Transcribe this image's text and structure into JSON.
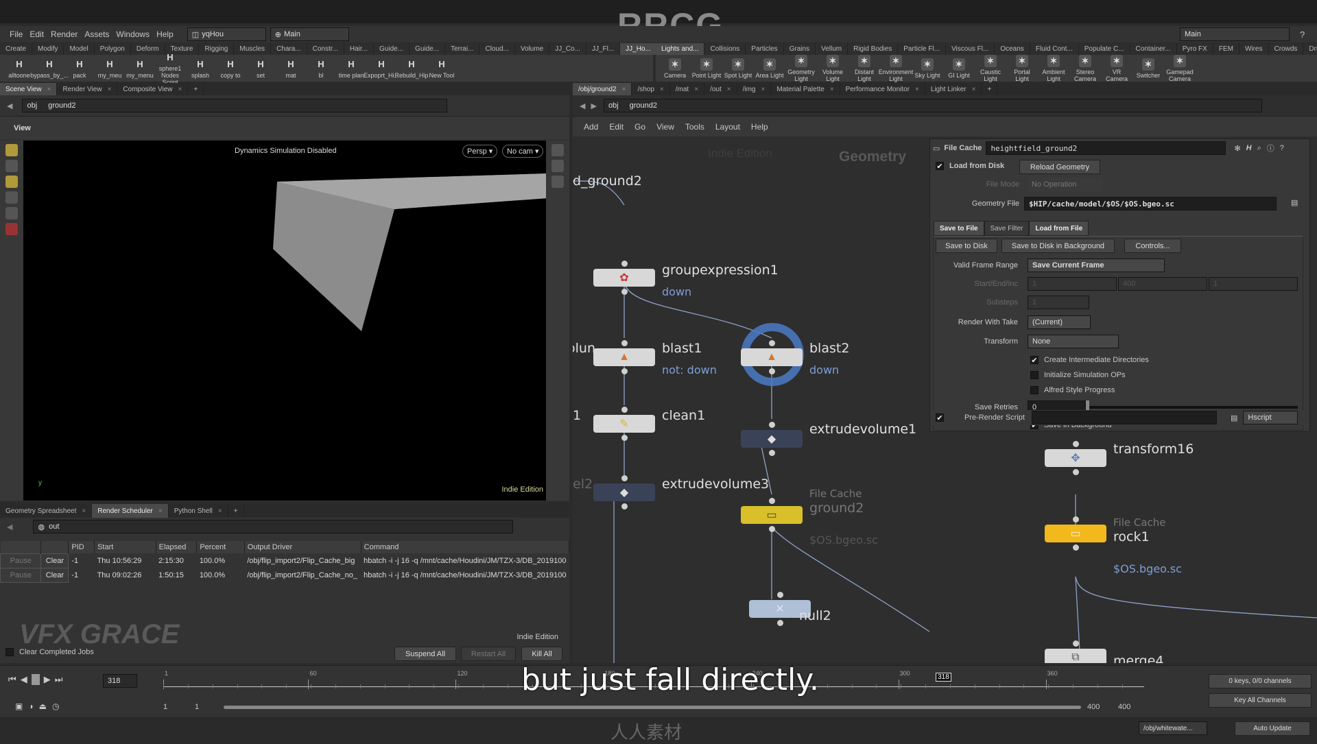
{
  "watermark_logo": "RRCG",
  "menu": {
    "items": [
      "File",
      "Edit",
      "Render",
      "Assets",
      "Windows",
      "Help"
    ],
    "desktop": "yqHou",
    "context": "Main",
    "right_desktop": "Main"
  },
  "shelf_left": {
    "tabs": [
      "Create",
      "Modify",
      "Model",
      "Polygon",
      "Deform",
      "Texture",
      "Rigging",
      "Muscles",
      "Chara...",
      "Constr...",
      "Hair...",
      "Guide...",
      "Guide...",
      "Terrai...",
      "Cloud...",
      "Volume",
      "JJ_Co...",
      "JJ_Fl...",
      "JJ_Ho..."
    ],
    "selected_tab": 18,
    "tools": [
      "alltoone",
      "bypass_by_...",
      "pack",
      "my_meu",
      "my_menu",
      "sphere1 Nodes Script",
      "splash",
      "copy to",
      "set",
      "mat",
      "bl",
      "time plan",
      "Expoprt_Hi...",
      "Rebuild_Hip",
      "New Tool"
    ]
  },
  "shelf_right": {
    "tabs": [
      "Lights and...",
      "Collisions",
      "Particles",
      "Grains",
      "Vellum",
      "Rigid Bodies",
      "Particle Fl...",
      "Viscous Fl...",
      "Oceans",
      "Fluid Cont...",
      "Populate C...",
      "Container...",
      "Pyro FX",
      "FEM",
      "Wires",
      "Crowds",
      "Drive Sim..."
    ],
    "selected_tab": 0,
    "tools": [
      "Camera",
      "Point Light",
      "Spot Light",
      "Area Light",
      "Geometry Light",
      "Volume Light",
      "Distant Light",
      "Environment Light",
      "Sky Light",
      "GI Light",
      "Caustic Light",
      "Portal Light",
      "Ambient Light",
      "Stereo Camera",
      "VR Camera",
      "Switcher",
      "Gamepad Camera"
    ]
  },
  "left_pane": {
    "tabs": [
      "Scene View",
      "Render View",
      "Composite View"
    ],
    "path": [
      "obj",
      "ground2"
    ],
    "view_label": "View",
    "viewport_message": "Dynamics Simulation Disabled",
    "persp": "Persp ▾",
    "cam": "No cam ▾",
    "edition": "Indie Edition",
    "axis_y": "y"
  },
  "scheduler": {
    "tabs": [
      "Geometry Spreadsheet",
      "Render Scheduler",
      "Python Shell"
    ],
    "selected_tab": 1,
    "path": "out",
    "columns": [
      "",
      "",
      "PID",
      "Start",
      "Elapsed",
      "Percent",
      "Output Driver",
      "Command"
    ],
    "rows": [
      {
        "pause": "Pause",
        "clear": "Clear",
        "pid": "-1",
        "start": "Thu 10:56:29",
        "elapsed": "2:15:30",
        "percent": "100.0%",
        "driver": "/obj/flip_import2/Flip_Cache_big",
        "command": "hbatch -i -j 16 -q /mnt/cache/Houdini/JM/TZX-3/DB_2019100"
      },
      {
        "pause": "Pause",
        "clear": "Clear",
        "pid": "-1",
        "start": "Thu 09:02:26",
        "elapsed": "1:50:15",
        "percent": "100.0%",
        "driver": "/obj/flip_import2/Flip_Cache_no_",
        "command": "hbatch -i -j 16 -q /mnt/cache/Houdini/JM/TZX-3/DB_2019100"
      }
    ],
    "edition": "Indie Edition",
    "clear_completed": "Clear Completed Jobs",
    "suspend_all": "Suspend All",
    "restart_all": "Restart All",
    "kill_all": "Kill All",
    "logo": "VFX GRACE"
  },
  "right_pane": {
    "tabs": [
      "/obj/ground2",
      "/shop",
      "/mat",
      "/out",
      "/img",
      "Material Palette",
      "Performance Monitor",
      "Light Linker"
    ],
    "path": [
      "obj",
      "ground2"
    ],
    "menu": [
      "Add",
      "Edit",
      "Go",
      "View",
      "Tools",
      "Layout",
      "Help"
    ],
    "network_watermark": "Indie Edition",
    "network_type": "Geometry"
  },
  "network": {
    "clipped_labels": [
      "d_ground2",
      "olun",
      "1",
      "el2"
    ],
    "nodes": [
      {
        "name": "groupexpression1",
        "sub": "down"
      },
      {
        "name": "blast1",
        "sub": "not: down"
      },
      {
        "name": "blast2",
        "sub": "down"
      },
      {
        "name": "clean1"
      },
      {
        "name": "extrudevolume1"
      },
      {
        "name": "extrudevolume3"
      },
      {
        "name": "ground2",
        "type": "File Cache",
        "sub": "$OS.bgeo.sc"
      },
      {
        "name": "null2"
      },
      {
        "name": "transform16"
      },
      {
        "name": "rock1",
        "type": "File Cache",
        "sub": "$OS.bgeo.sc"
      },
      {
        "name": "merge4"
      }
    ]
  },
  "params": {
    "type": "File Cache",
    "node_name": "heightfield_ground2",
    "load_from_disk": {
      "label": "Load from Disk",
      "checked": true
    },
    "reload": "Reload Geometry",
    "file_mode": {
      "label": "File Mode",
      "value": "No Operation"
    },
    "geometry_file": {
      "label": "Geometry File",
      "value": "$HIP/cache/model/$OS/$OS.bgeo.sc"
    },
    "tabs": [
      "Save to File",
      "Save Filter",
      "Load from File"
    ],
    "save_to_disk": "Save to Disk",
    "save_bg": "Save to Disk in Background",
    "controls": "Controls...",
    "valid_frame_range": {
      "label": "Valid Frame Range",
      "value": "Save Current Frame"
    },
    "start_end_inc": {
      "label": "Start/End/Inc",
      "values": [
        "1",
        "400",
        "1"
      ]
    },
    "substeps": {
      "label": "Substeps",
      "value": "1"
    },
    "render_with_take": {
      "label": "Render With Take",
      "value": "(Current)"
    },
    "transform": {
      "label": "Transform",
      "value": "None"
    },
    "toggles": [
      {
        "label": "Create Intermediate Directories",
        "checked": true
      },
      {
        "label": "Initialize Simulation OPs",
        "checked": false
      },
      {
        "label": "Alfred Style Progress",
        "checked": false
      }
    ],
    "save_retries": {
      "label": "Save Retries",
      "value": "0"
    },
    "save_in_background": {
      "label": "Save in Background",
      "checked": true
    },
    "pre_render": {
      "label": "Pre-Render Script",
      "checked": true,
      "language": "Hscript"
    }
  },
  "timeline": {
    "current_frame": "318",
    "start": 1,
    "end": 400,
    "ticks": [
      "1",
      "60",
      "120",
      "180",
      "240",
      "300",
      "360"
    ],
    "range_start": "1",
    "range_start2": "1",
    "range_end": "400",
    "range_end2": "400",
    "keys": "0 keys, 0/0 channels",
    "key_all": "Key All Channels"
  },
  "status": {
    "path": "/obj/whitewate...",
    "update": "Auto Update",
    "logo": "人人素材"
  },
  "subtitle": "but just fall directly.",
  "colors": {
    "accent_blue": "#4a7ac6",
    "file_cache_yellow": "#f2b81c",
    "bg": "#2b2b2b"
  }
}
